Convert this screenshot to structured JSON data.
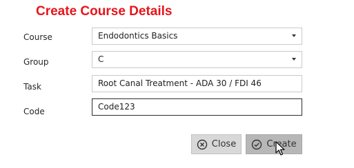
{
  "window": {
    "title": "Create Course Details"
  },
  "form": {
    "course": {
      "label": "Course",
      "value": "Endodontics Basics"
    },
    "group": {
      "label": "Group",
      "value": "C"
    },
    "task": {
      "label": "Task",
      "value": "Root Canal Treatment - ADA 30 / FDI 46"
    },
    "code": {
      "label": "Code",
      "value": "Code123"
    }
  },
  "buttons": {
    "close_label": "Close",
    "create_label": "Create"
  },
  "icons": {
    "close": "x-circle-icon",
    "create": "check-circle-icon",
    "dropdown": "chevron-down-icon",
    "cursor": "mouse-pointer-icon"
  },
  "colors": {
    "title": "#e8141b",
    "button_bg": "#cfcfcf",
    "button_pressed_bg": "#b7b7b7"
  }
}
